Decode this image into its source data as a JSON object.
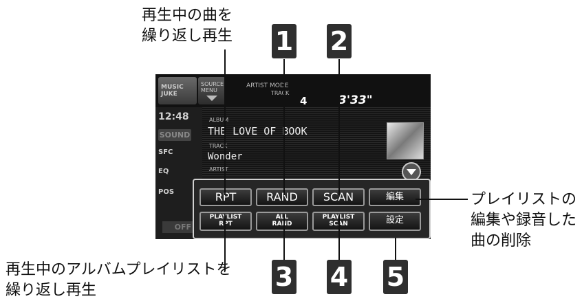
{
  "callouts": {
    "top_left": [
      "再生中の曲を",
      "繰り返し再生"
    ],
    "right": [
      "プレイリストの",
      "編集や録音した",
      "曲の削除"
    ],
    "bottom_left": [
      "再生中のアルバムプレイリストを",
      "繰り返し再生"
    ]
  },
  "numbers": [
    "1",
    "2",
    "3",
    "4",
    "5"
  ],
  "screen": {
    "source_logo": [
      "MUSIC",
      "JUKE"
    ],
    "source_menu": [
      "SOURCE",
      "MENU"
    ],
    "mode_label": "ARTIST MODE",
    "track_label": "TRACK",
    "track_number": "4",
    "time": "3'33\"",
    "clock": "12:48",
    "sound": "SOUND",
    "sfc": "SFC",
    "eq": "EQ",
    "pos": "POS",
    "off": "OFF",
    "album_label": "ALBUM",
    "album_value": "THE LOVE OF BOOK",
    "track_field_label": "TRACK",
    "track_title": "Wonder",
    "artist_label": "ARTIST"
  },
  "buttons_row1": [
    "RPT",
    "RAND",
    "SCAN",
    "編集"
  ],
  "buttons_row2": [
    {
      "line1": "PLAYLIST",
      "line2": "RPT"
    },
    {
      "line1": "ALL",
      "line2": "RAND"
    },
    {
      "line1": "PLAYLIST",
      "line2": "SCAN"
    },
    {
      "line1": "設定",
      "line2": ""
    }
  ]
}
